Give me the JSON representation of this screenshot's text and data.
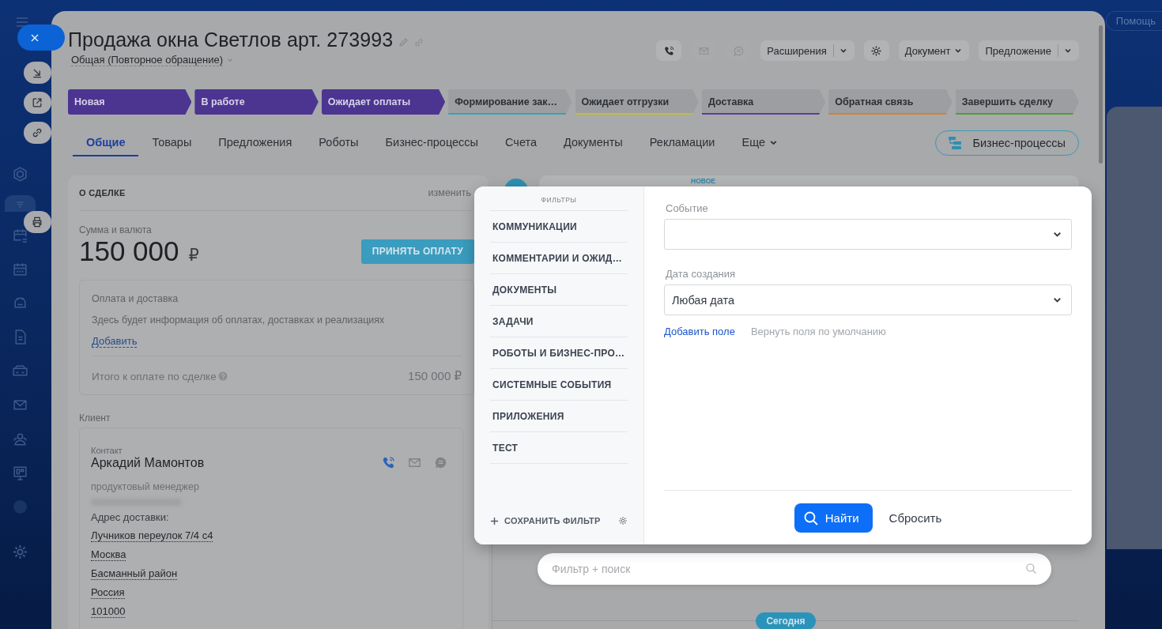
{
  "help": "Помощь",
  "deal": {
    "title": "Продажа окна Светлов арт. 273993",
    "category": "Общая (Повторное обращение)"
  },
  "toolbar": [
    {
      "kind": "phone"
    },
    {
      "kind": "mail"
    },
    {
      "kind": "chat"
    },
    {
      "kind": "split",
      "label": "Расширения"
    },
    {
      "kind": "gear"
    },
    {
      "kind": "dropdown",
      "label": "Документ"
    },
    {
      "kind": "split",
      "label": "Предложение"
    }
  ],
  "stages": [
    {
      "label": "Новая",
      "color": "#4b3591",
      "passed": true
    },
    {
      "label": "В работе",
      "color": "#4b3591",
      "passed": true
    },
    {
      "label": "Ожидает оплаты",
      "color": "#4b3591",
      "passed": true
    },
    {
      "label": "Формирование зак…",
      "color": "#37a3b8",
      "passed": false
    },
    {
      "label": "Ожидает отгрузки",
      "color": "#c6bd2c",
      "passed": false
    },
    {
      "label": "Доставка",
      "color": "#5b3e98",
      "passed": false
    },
    {
      "label": "Обратная связь",
      "color": "#d2822c",
      "passed": false
    },
    {
      "label": "Завершить сделку",
      "color": "#4f9f33",
      "passed": false
    }
  ],
  "tabs": [
    {
      "label": "Общие",
      "selected": true,
      "kind": "tab"
    },
    {
      "label": "Товары",
      "selected": false,
      "kind": "tab"
    },
    {
      "label": "Предложения",
      "selected": false,
      "kind": "tab"
    },
    {
      "label": "Роботы",
      "selected": false,
      "kind": "tab"
    },
    {
      "label": "Бизнес-процессы",
      "selected": false,
      "kind": "tab"
    },
    {
      "label": "Счета",
      "selected": false,
      "kind": "tab"
    },
    {
      "label": "Документы",
      "selected": false,
      "kind": "tab"
    },
    {
      "label": "Рекламации",
      "selected": false,
      "kind": "tab"
    },
    {
      "label": "Еще",
      "selected": false,
      "kind": "more"
    }
  ],
  "process_button": "Бизнес-процессы",
  "about": {
    "title": "О СДЕЛКЕ",
    "edit": "изменить",
    "amount_label": "Сумма и валюта",
    "amount": "150 000",
    "currency": "₽",
    "pay_button": "ПРИНЯТЬ ОПЛАТУ",
    "payment": {
      "title": "Оплата и доставка",
      "text": "Здесь будет информация об оплатах, доставках и реализациях",
      "add": "Добавить",
      "total_label": "Итого к оплате по сделке",
      "total": "150 000 ₽"
    },
    "client_label": "Клиент",
    "contact": {
      "label": "Контакт",
      "name": "Аркадий Мамонтов",
      "position": "продуктовый менеджер",
      "address_label": "Адрес доставки:",
      "address": [
        "Лучников переулок 7/4 с4",
        "Москва",
        "Басманный район",
        "Россия",
        "101000"
      ]
    }
  },
  "timeline": {
    "new_badge": "НОВОЕ",
    "search_placeholder": "Фильтр + поиск",
    "today": "Сегодня"
  },
  "filter": {
    "heading": "ФИЛЬТРЫ",
    "presets": [
      "КОММУНИКАЦИИ",
      "КОММЕНТАРИИ И ОЖИД…",
      "ДОКУМЕНТЫ",
      "ЗАДАЧИ",
      "РОБОТЫ И БИЗНЕС-ПРО…",
      "СИСТЕМНЫЕ СОБЫТИЯ",
      "ПРИЛОЖЕНИЯ",
      "ТЕСТ"
    ],
    "save": "СОХРАНИТЬ ФИЛЬТР",
    "fields": [
      {
        "label": "Событие"
      },
      {
        "label": "Дата создания",
        "value": "Любая дата"
      }
    ],
    "add_field": "Добавить поле",
    "reset_fields": "Вернуть поля по умолчанию",
    "find": "Найти",
    "reset": "Сбросить"
  }
}
